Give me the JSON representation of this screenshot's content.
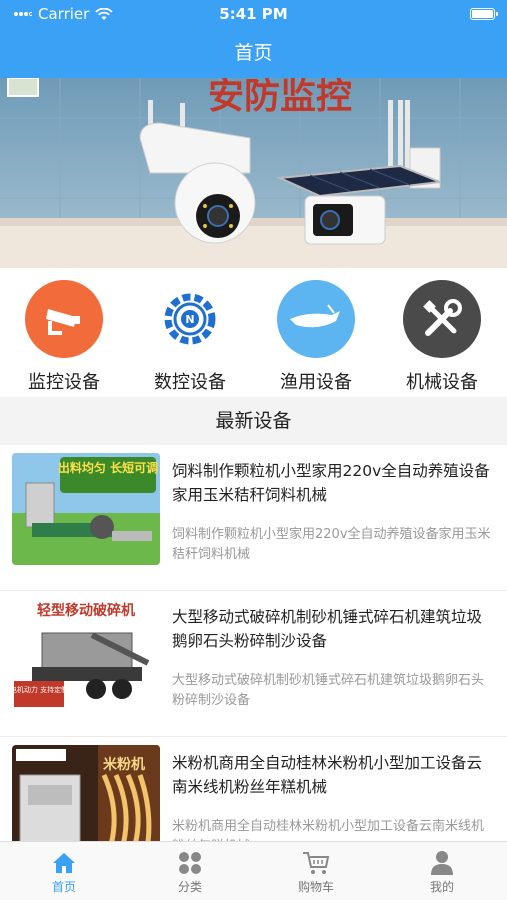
{
  "status_bar": {
    "carrier": "Carrier",
    "time": "5:41 PM"
  },
  "nav": {
    "title": "首页"
  },
  "banner": {
    "text": "安防监控"
  },
  "categories": [
    {
      "label": "监控设备",
      "icon": "camera-icon",
      "color": "#f26b3a"
    },
    {
      "label": "数控设备",
      "icon": "gear-icon",
      "color": "#1f6fd0"
    },
    {
      "label": "渔用设备",
      "icon": "boat-icon",
      "color": "#5cb4f0"
    },
    {
      "label": "机械设备",
      "icon": "tools-icon",
      "color": "#4a4a4a"
    }
  ],
  "section": {
    "title": "最新设备"
  },
  "products": [
    {
      "title": "饲料制作颗粒机小型家用220v全自动养殖设备家用玉米秸秆饲料机械",
      "desc": "饲料制作颗粒机小型家用220v全自动养殖设备家用玉米秸秆饲料机械",
      "thumb_text": "出料均匀 长短可调"
    },
    {
      "title": "大型移动式破碎机制砂机锤式碎石机建筑垃圾鹅卵石头粉碎制沙设备",
      "desc": "大型移动式破碎机制砂机锤式碎石机建筑垃圾鹅卵石头粉碎制沙设备",
      "thumb_text": "轻型移动破碎机",
      "thumb_text2": "电机动力 支持定制"
    },
    {
      "title": "米粉机商用全自动桂林米粉机小型加工设备云南米线机粉丝年糕机械",
      "desc": "米粉机商用全自动桂林米粉机小型加工设备云南米线机粉丝年糕机械",
      "thumb_text": "米粉机"
    }
  ],
  "tabbar": [
    {
      "label": "首页",
      "icon": "home-icon",
      "active": true
    },
    {
      "label": "分类",
      "icon": "grid-icon",
      "active": false
    },
    {
      "label": "购物车",
      "icon": "cart-icon",
      "active": false
    },
    {
      "label": "我的",
      "icon": "user-icon",
      "active": false
    }
  ]
}
